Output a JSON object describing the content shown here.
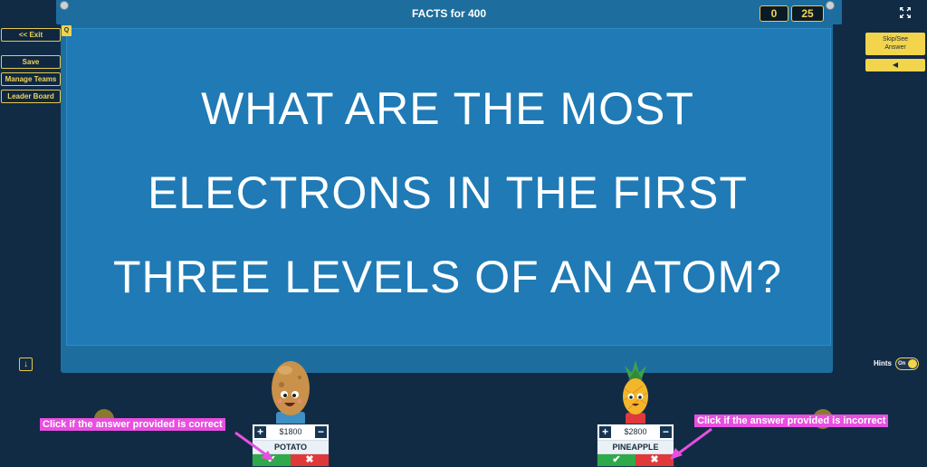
{
  "header": {
    "title": "FACTS for 400",
    "score": "0",
    "timer": "25"
  },
  "left_menu": {
    "exit": "<< Exit",
    "save": "Save",
    "manage_teams": "Manage Teams",
    "leader_board": "Leader Board",
    "q_badge": "Q"
  },
  "question": {
    "line1": "WHAT ARE THE MOST",
    "line2": "ELECTRONS IN THE FIRST",
    "line3": "THREE LEVELS OF AN ATOM?"
  },
  "right_panel": {
    "skip_line1": "Skip/See",
    "skip_line2": "Answer",
    "back_arrow": "◀",
    "hints_label": "Hints",
    "hints_toggle": "On"
  },
  "teams": [
    {
      "name": "POTATO",
      "money": "$1800"
    },
    {
      "name": "PINEAPPLE",
      "money": "$2800"
    }
  ],
  "callouts": {
    "correct": "Click if the answer provided is correct",
    "incorrect": "Click if the answer provided is incorrect"
  },
  "colors": {
    "background": "#112b45",
    "board": "#1f7ab5",
    "accent_yellow": "#f2d44d",
    "callout_pink": "#e84fe0",
    "correct_green": "#2eaa4a",
    "incorrect_red": "#e0393b"
  },
  "icons": {
    "fullscreen": "expand-arrows-icon",
    "correct": "check-icon",
    "incorrect": "x-icon",
    "down": "down-arrow-icon"
  }
}
